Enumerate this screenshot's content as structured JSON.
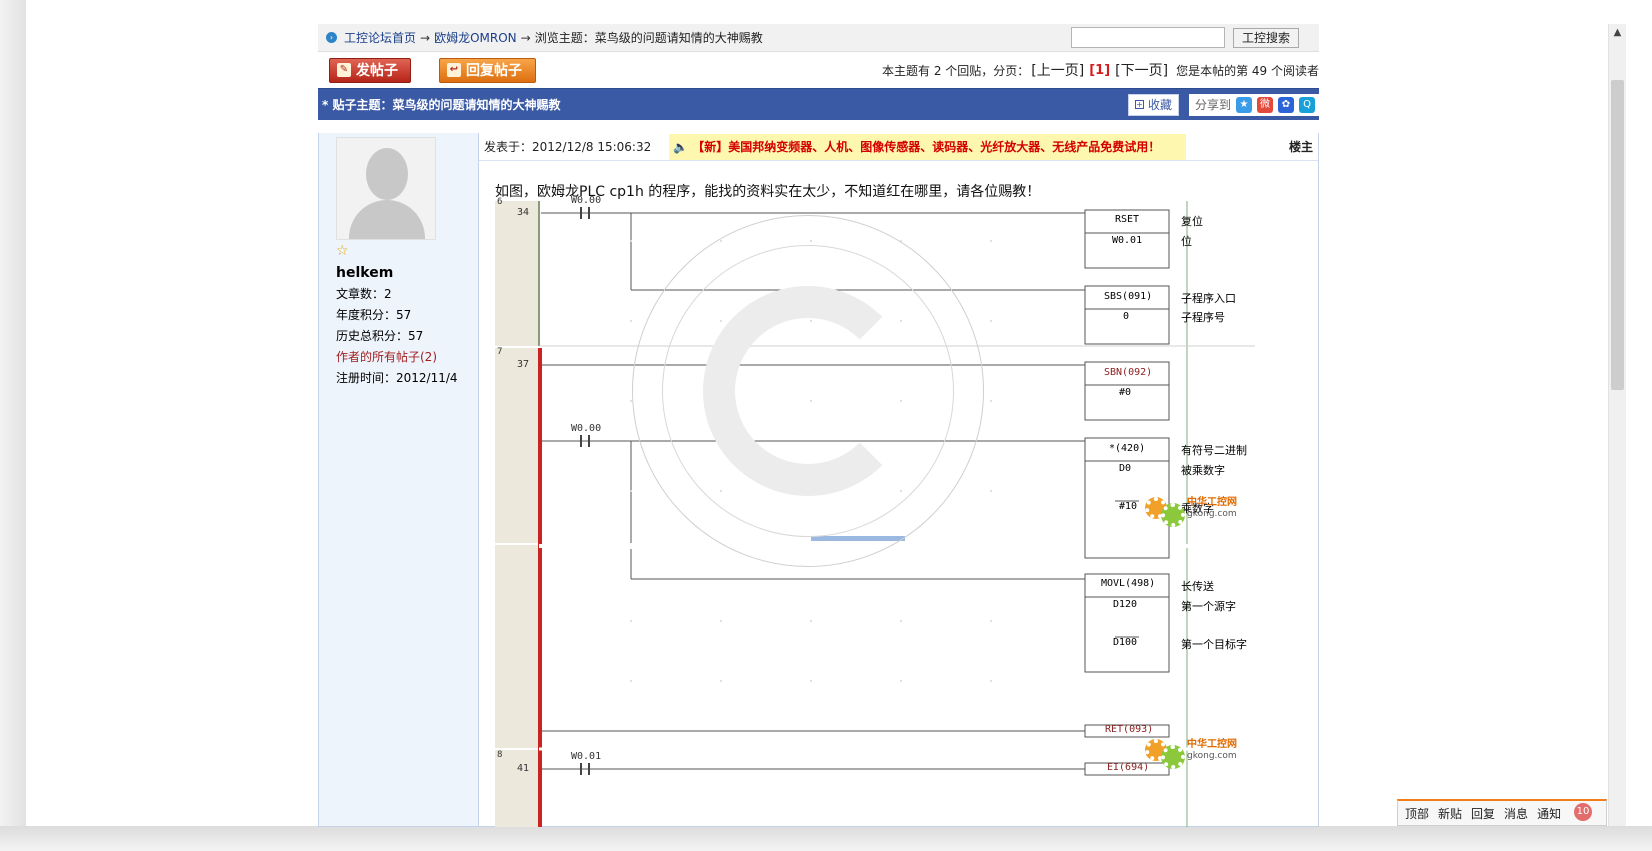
{
  "breadcrumb": {
    "home": "工控论坛首页",
    "arrow": "→",
    "category": "欧姆龙OMRON",
    "topic_prefix": "浏览主题：",
    "topic": "菜鸟级的问题请知情的大神赐教"
  },
  "search": {
    "button_label": "工控搜索",
    "placeholder": ""
  },
  "actions": {
    "new_post": "发帖子",
    "reply_post": "回复帖子"
  },
  "pager": {
    "summary": "本主题有 2 个回贴，分页：",
    "prev": "[上一页]",
    "current": "[1]",
    "next": "[下一页]",
    "reader": "您是本帖的第 49 个阅读者"
  },
  "title_bar": {
    "title": "* 贴子主题：菜鸟级的问题请知情的大神赐教",
    "favorite": "收藏",
    "share": "分享到"
  },
  "profile": {
    "username": "helkem",
    "posts": "文章数：2",
    "year_points": "年度积分：57",
    "total_points": "历史总积分：57",
    "all_posts": "作者的所有帖子(2)",
    "registered": "注册时间：2012/11/4"
  },
  "post": {
    "posted_at": "发表于：2012/12/8 15:06:32",
    "ad": "【新】美国邦纳变频器、人机、图像传感器、读码器、光纤放大器、无线产品免费试用！",
    "floor": "楼主",
    "text": "如图，欧姆龙PLC   cp1h 的程序，能找的资料实在太少，不知道红在哪里，请各位赐教！"
  },
  "ladder": {
    "rungs": [
      {
        "num": "6",
        "step": "34",
        "contact": "W0.00"
      },
      {
        "num": "7",
        "step": "37",
        "contact": "W0.00"
      },
      {
        "num": "8",
        "step": "41",
        "contact": "W0.01"
      }
    ],
    "boxes": [
      {
        "op": "RSET",
        "arg1": "W0.01",
        "c1": "复位",
        "c2": "位"
      },
      {
        "op": "SBS(091)",
        "arg1": "0",
        "c1": "子程序入口",
        "c2": "子程序号"
      },
      {
        "op": "SBN(092)",
        "arg1": "#0"
      },
      {
        "op": "*(420)",
        "arg1": "D0",
        "arg2": "#10",
        "c1": "有符号二进制",
        "c2": "被乘数字",
        "c3": "乘数字"
      },
      {
        "op": "MOVL(498)",
        "arg1": "D120",
        "arg2": "D100",
        "c1": "长传送",
        "c2": "第一个源字",
        "c3": "第一个目标字"
      },
      {
        "op": "RET(093)"
      },
      {
        "op": "EI(694)"
      }
    ],
    "logo_cn": "中华工控网",
    "logo_url": "gkong.com"
  },
  "bottom_toolbar": {
    "top": "顶部",
    "new": "新贴",
    "reply": "回复",
    "message": "消息",
    "notify": "通知",
    "count": "10"
  }
}
